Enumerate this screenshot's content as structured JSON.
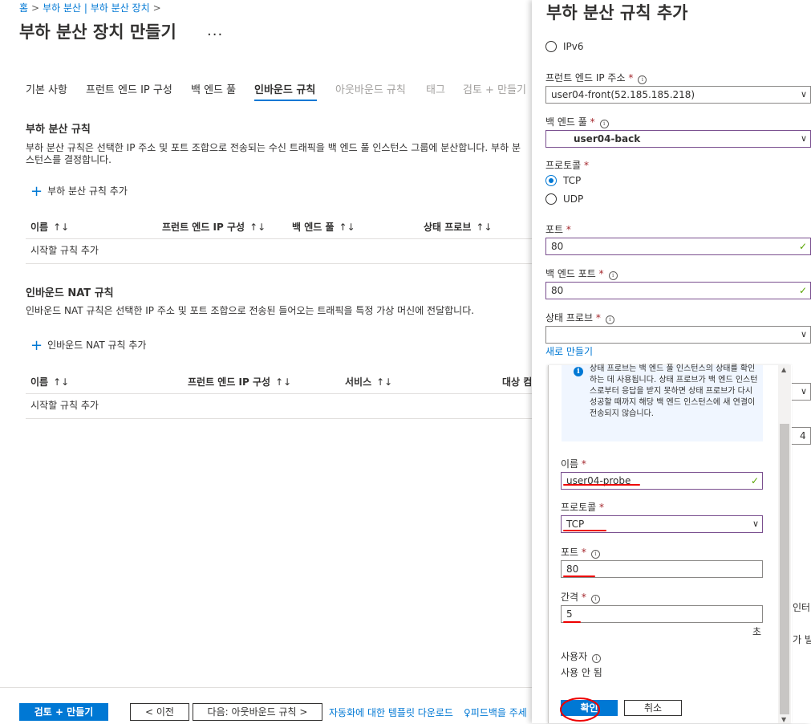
{
  "breadcrumb": [
    "홈",
    "부하 분산 | 부하 분산 장치"
  ],
  "page": {
    "title": "부하 분산 장치 만들기",
    "more": "..."
  },
  "tabs": [
    "기본 사항",
    "프런트 엔드 IP 구성",
    "백 엔드 풀",
    "인바운드 규칙",
    "아웃바운드 규칙",
    "태그",
    "검토 + 만들기"
  ],
  "lb_rules": {
    "title": "부하 분산 규칙",
    "desc1": "부하 분산 규칙은 선택한 IP 주소 및 포트 조합으로 전송되는 수신 트래픽을 백 엔드 풀 인스턴스 그룹에 분산합니다. 부하 분",
    "desc2": "스턴스를 결정합니다.",
    "add": "부하 분산 규칙 추가",
    "columns": [
      "이름",
      "프런트 엔드 IP 구성",
      "백 엔드 풀",
      "상태 프로브"
    ],
    "sort": "↑↓",
    "empty": "시작할 규칙 추가"
  },
  "nat_rules": {
    "title": "인바운드 NAT 규칙",
    "desc": "인바운드 NAT 규칙은 선택한 IP 주소 및 포트 조합으로 전송된 들어오는 트래픽을 특정 가상 머신에 전달합니다.",
    "add": "인바운드 NAT 규칙 추가",
    "columns": [
      "이름",
      "프런트 엔드 IP 구성",
      "서비스",
      "대상 컴"
    ],
    "sort": "↑↓",
    "empty": "시작할 규칙 추가"
  },
  "footer": {
    "review": "검토 + 만들기",
    "prev": "< 이전",
    "next": "다음: 아웃바운드 규칙 >",
    "template": "자동화에 대한 템플릿 다운로드",
    "feedback": "피드백을 주세"
  },
  "panel": {
    "title": "부하 분산 규칙 추가",
    "ipv6": "IPv6",
    "frontend_label": "프런트 엔드 IP 주소",
    "frontend_value": "user04-front(52.185.185.218)",
    "backend_label": "백 엔드 풀",
    "backend_value": "user04-back",
    "protocol_label": "프로토콜",
    "tcp": "TCP",
    "udp": "UDP",
    "port_label": "포트",
    "port_value": "80",
    "backend_port_label": "백 엔드 포트",
    "backend_port_value": "80",
    "probe_label": "상태 프로브",
    "probe_value": "",
    "create_new": "새로 만들기",
    "peek1": "인터",
    "peek2": "가 빌",
    "peek3": "4",
    "req": "*"
  },
  "probe_popup": {
    "info_text": "상태 프로브는 백 엔드 풀 인스턴스의 상태를 확인하는 데 사용됩니다. 상태 프로브가 백 엔드 인스턴스로부터 응답을 받지 못하면 상태 프로브가 다시 성공할 때까지 해당 백 엔드 인스턴스에 새 연결이 전송되지 않습니다.",
    "name_label": "이름",
    "name_value": "user04-probe",
    "protocol_label": "프로토콜",
    "protocol_value": "TCP",
    "port_label": "포트",
    "port_value": "80",
    "interval_label": "간격",
    "interval_value": "5",
    "interval_unit": "초",
    "user_label": "사용자",
    "user_value": "사용 안 됨",
    "ok": "확인",
    "cancel": "취소"
  }
}
